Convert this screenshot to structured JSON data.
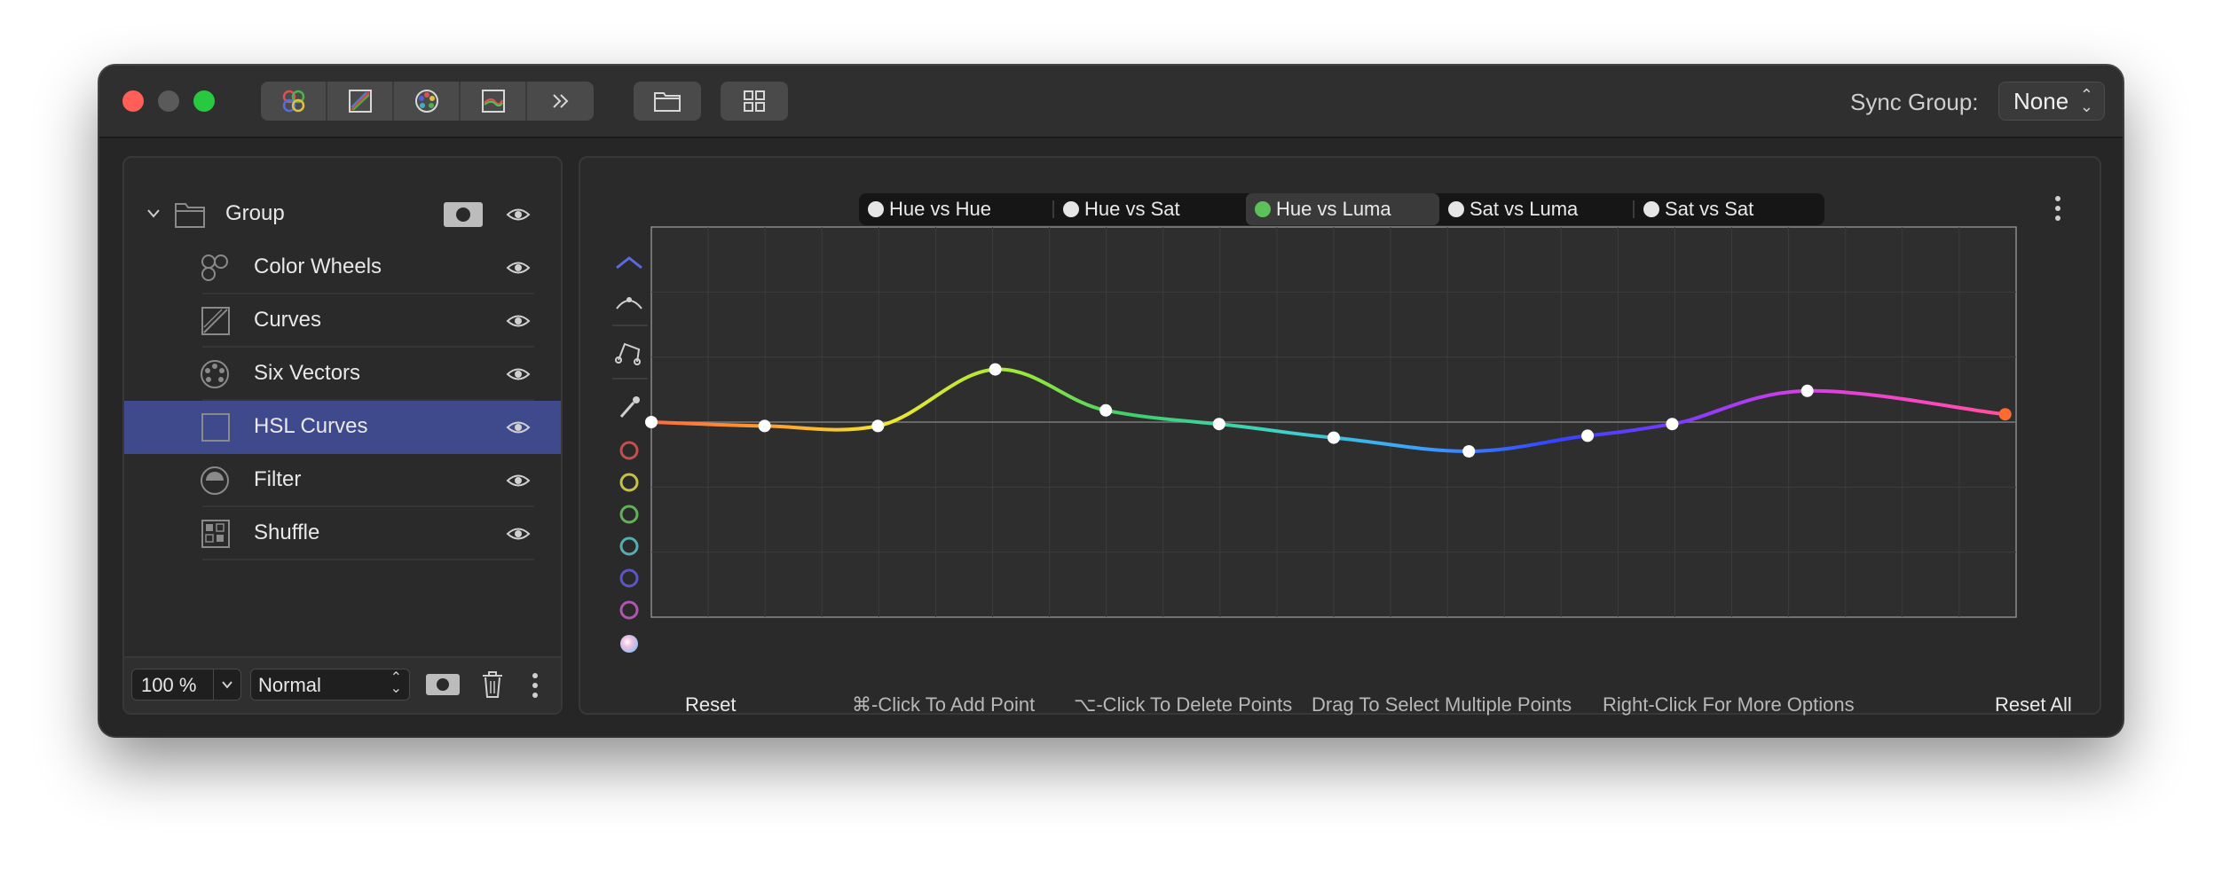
{
  "toolbar": {
    "buttons": [
      "color-wheels-icon",
      "curves-icon",
      "six-vectors-icon",
      "hsl-curves-icon",
      "more-chevrons-icon"
    ],
    "folder": "folder-icon",
    "grid": "grid-icon"
  },
  "sync": {
    "label": "Sync Group:",
    "value": "None"
  },
  "layers": [
    {
      "label": "Group",
      "icon": "folder-icon",
      "selected": false,
      "group": true
    },
    {
      "label": "Color Wheels",
      "icon": "color-wheels-icon",
      "selected": false
    },
    {
      "label": "Curves",
      "icon": "curves-icon",
      "selected": false
    },
    {
      "label": "Six Vectors",
      "icon": "six-vectors-icon",
      "selected": false
    },
    {
      "label": "HSL Curves",
      "icon": "hsl-curves-icon",
      "selected": true
    },
    {
      "label": "Filter",
      "icon": "filter-icon",
      "selected": false
    },
    {
      "label": "Shuffle",
      "icon": "shuffle-icon",
      "selected": false
    }
  ],
  "footer": {
    "opacity": "100 %",
    "blend_mode": "Normal"
  },
  "tabs": [
    {
      "label": "Hue vs Hue",
      "active": false
    },
    {
      "label": "Hue vs Sat",
      "active": false
    },
    {
      "label": "Hue vs Luma",
      "active": true
    },
    {
      "label": "Sat vs Luma",
      "active": false
    },
    {
      "label": "Sat vs Sat",
      "active": false
    }
  ],
  "bottom": {
    "reset": "Reset",
    "hint_add": "⌘-Click To Add Point",
    "hint_delete": "⌥-Click To Delete Points",
    "hint_drag": "Drag To Select Multiple Points",
    "hint_right": "Right-Click For More Options",
    "reset_all": "Reset All"
  },
  "tool_colors": [
    "#c0514d",
    "#c4c04a",
    "#62b05a",
    "#55adb0",
    "#5a58c0",
    "#b055b0"
  ],
  "chart_data": {
    "type": "line",
    "xlim": [
      0,
      1
    ],
    "ylim": [
      -1,
      1
    ],
    "grid": true,
    "control_points": [
      [
        0.0,
        0.0
      ],
      [
        0.083,
        -0.02
      ],
      [
        0.166,
        -0.02
      ],
      [
        0.252,
        0.27
      ],
      [
        0.333,
        0.06
      ],
      [
        0.416,
        -0.01
      ],
      [
        0.5,
        -0.08
      ],
      [
        0.599,
        -0.15
      ],
      [
        0.686,
        -0.07
      ],
      [
        0.748,
        -0.01
      ],
      [
        0.847,
        0.16
      ],
      [
        0.992,
        0.04
      ]
    ]
  }
}
